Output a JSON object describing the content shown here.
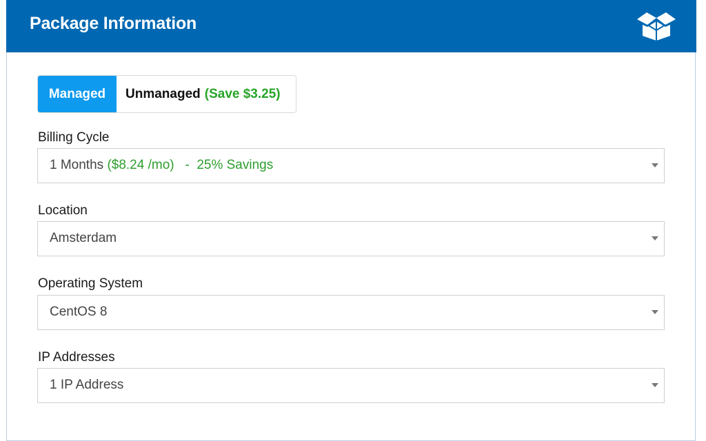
{
  "header": {
    "title": "Package Information",
    "icon": "open-box-icon",
    "background": "#0068b2"
  },
  "management_toggle": {
    "managed_label": "Managed",
    "unmanaged_label": "Unmanaged",
    "unmanaged_savings": "(Save $3.25)",
    "selected": "Managed",
    "active_color": "#0d9aef"
  },
  "billing_cycle": {
    "label": "Billing Cycle",
    "value_term": "1 Months",
    "value_price": "($8.24 /mo)",
    "value_separator": "-",
    "value_savings": "25% Savings"
  },
  "location": {
    "label": "Location",
    "value": "Amsterdam"
  },
  "operating_system": {
    "label": "Operating System",
    "value": "CentOS 8"
  },
  "ip_addresses": {
    "label": "IP Addresses",
    "value": "1 IP Address"
  },
  "colors": {
    "savings_green": "#2e9e2e"
  }
}
